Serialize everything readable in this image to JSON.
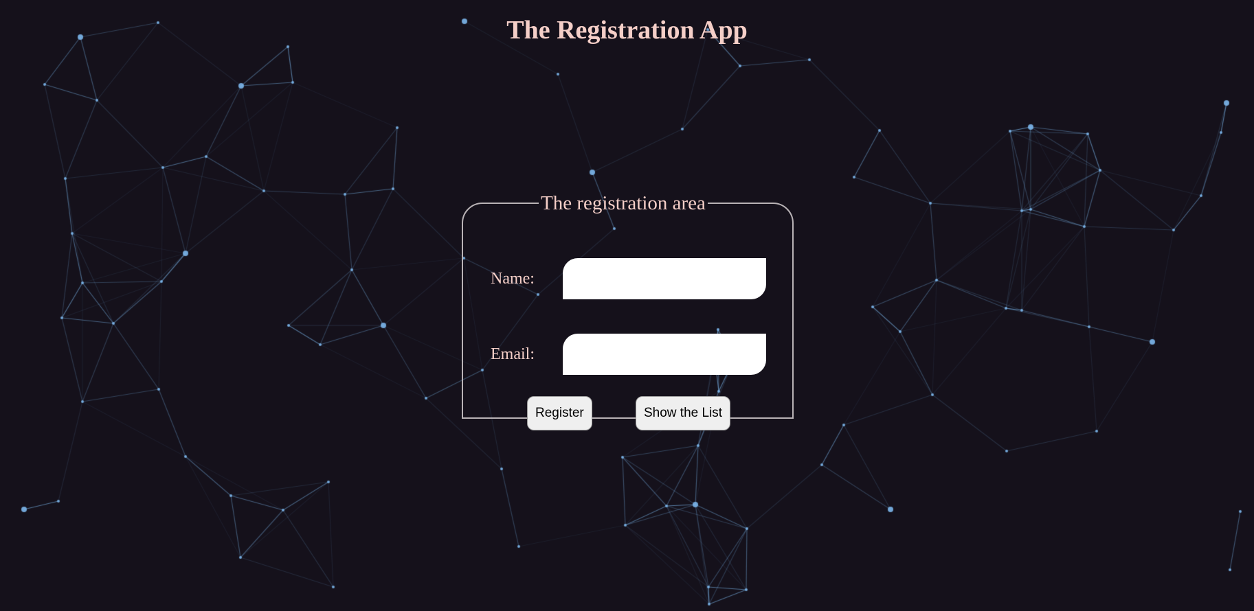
{
  "page": {
    "title": "The Registration App",
    "background_color": "#15111b",
    "title_color": "#f5cfc8",
    "network_line_color": "#7cb7ec"
  },
  "registration": {
    "legend": "The registration area",
    "name_label": "Name:",
    "name_value": "",
    "email_label": "Email:",
    "email_value": "",
    "register_button": "Register",
    "show_list_button": "Show the List"
  }
}
